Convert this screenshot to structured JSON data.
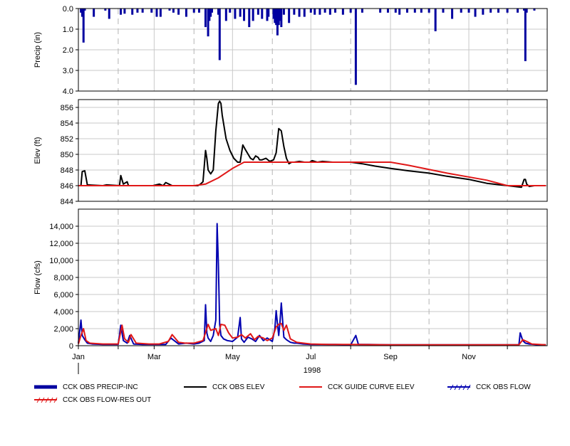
{
  "chart_data": [
    {
      "type": "bar",
      "panel": "precip",
      "ylabel": "Precip (in)",
      "ylim": [
        0,
        4
      ],
      "y_inverted": true,
      "yticks": [
        "0.0",
        "1.0",
        "2.0",
        "3.0",
        "4.0"
      ],
      "grid": true,
      "color": "#0000a0",
      "series": [
        {
          "name": "CCK OBS PRECIP-INC",
          "x": [
            "1998-01-03",
            "1998-01-04",
            "1998-01-05",
            "1998-01-06",
            "1998-01-13",
            "1998-01-22",
            "1998-01-25",
            "1998-02-03",
            "1998-02-06",
            "1998-02-12",
            "1998-02-16",
            "1998-02-20",
            "1998-02-27",
            "1998-03-03",
            "1998-03-06",
            "1998-03-13",
            "1998-03-16",
            "1998-03-20",
            "1998-03-26",
            "1998-04-01",
            "1998-04-05",
            "1998-04-10",
            "1998-04-12",
            "1998-04-13",
            "1998-04-14",
            "1998-04-15",
            "1998-04-20",
            "1998-04-21",
            "1998-04-26",
            "1998-04-29",
            "1998-05-03",
            "1998-05-07",
            "1998-05-10",
            "1998-05-14",
            "1998-05-17",
            "1998-05-21",
            "1998-05-24",
            "1998-05-28",
            "1998-05-29",
            "1998-06-02",
            "1998-06-03",
            "1998-06-04",
            "1998-06-05",
            "1998-06-06",
            "1998-06-07",
            "1998-06-08",
            "1998-06-10",
            "1998-06-14",
            "1998-06-18",
            "1998-06-22",
            "1998-06-26",
            "1998-07-01",
            "1998-07-04",
            "1998-07-08",
            "1998-07-12",
            "1998-07-16",
            "1998-07-20",
            "1998-07-26",
            "1998-08-01",
            "1998-08-05",
            "1998-08-10",
            "1998-08-24",
            "1998-08-30",
            "1998-09-05",
            "1998-09-08",
            "1998-09-14",
            "1998-09-20",
            "1998-09-25",
            "1998-10-01",
            "1998-10-06",
            "1998-10-12",
            "1998-10-19",
            "1998-10-26",
            "1998-11-01",
            "1998-11-06",
            "1998-11-12",
            "1998-11-18",
            "1998-11-24",
            "1998-12-01",
            "1998-12-09",
            "1998-12-14",
            "1998-12-15",
            "1998-12-16",
            "1998-12-22"
          ],
          "values": [
            0.2,
            0.4,
            1.65,
            0.1,
            0.4,
            0.1,
            0.5,
            0.3,
            0.25,
            0.3,
            0.2,
            0.2,
            0.2,
            0.4,
            0.4,
            0.1,
            0.2,
            0.3,
            0.4,
            0.2,
            0.2,
            0.9,
            1.35,
            0.6,
            0.4,
            0.2,
            0.3,
            2.5,
            0.6,
            0.2,
            0.5,
            0.4,
            0.6,
            0.9,
            0.6,
            0.3,
            0.5,
            0.6,
            0.4,
            0.5,
            0.7,
            0.8,
            1.3,
            0.8,
            0.6,
            0.9,
            0.3,
            0.7,
            0.3,
            0.4,
            0.4,
            0.2,
            0.3,
            0.3,
            0.2,
            0.3,
            0.2,
            0.3,
            0.2,
            3.7,
            0.2,
            0.2,
            0.2,
            0.2,
            0.3,
            0.2,
            0.2,
            0.2,
            0.2,
            1.1,
            0.2,
            0.5,
            0.2,
            0.2,
            0.4,
            0.3,
            0.2,
            0.2,
            0.2,
            0.2,
            0.1,
            2.55,
            0.2,
            0.1
          ]
        }
      ]
    },
    {
      "type": "line",
      "panel": "elev",
      "ylabel": "Elev (ft)",
      "ylim": [
        844,
        857
      ],
      "yticks": [
        "844",
        "846",
        "848",
        "850",
        "852",
        "854",
        "856"
      ],
      "grid": true,
      "series": [
        {
          "name": "CCK OBS ELEV",
          "color": "#000000",
          "x": [
            "1998-01-01",
            "1998-01-03",
            "1998-01-04",
            "1998-01-06",
            "1998-01-08",
            "1998-01-20",
            "1998-01-23",
            "1998-02-02",
            "1998-02-03",
            "1998-02-05",
            "1998-02-08",
            "1998-02-09",
            "1998-02-12",
            "1998-02-28",
            "1998-03-05",
            "1998-03-08",
            "1998-03-10",
            "1998-03-15",
            "1998-03-25",
            "1998-04-01",
            "1998-04-04",
            "1998-04-06",
            "1998-04-08",
            "1998-04-10",
            "1998-04-11",
            "1998-04-12",
            "1998-04-14",
            "1998-04-16",
            "1998-04-18",
            "1998-04-20",
            "1998-04-21",
            "1998-04-22",
            "1998-04-23",
            "1998-04-26",
            "1998-04-29",
            "1998-05-02",
            "1998-05-05",
            "1998-05-07",
            "1998-05-09",
            "1998-05-11",
            "1998-05-15",
            "1998-05-17",
            "1998-05-19",
            "1998-05-21",
            "1998-05-22",
            "1998-05-24",
            "1998-05-27",
            "1998-05-30",
            "1998-06-02",
            "1998-06-04",
            "1998-06-06",
            "1998-06-08",
            "1998-06-10",
            "1998-06-12",
            "1998-06-14",
            "1998-06-16",
            "1998-06-18",
            "1998-06-22",
            "1998-06-26",
            "1998-06-30",
            "1998-07-02",
            "1998-07-06",
            "1998-07-10",
            "1998-07-18",
            "1998-07-25",
            "1998-08-01",
            "1998-08-10",
            "1998-08-20",
            "1998-09-01",
            "1998-09-15",
            "1998-10-01",
            "1998-10-15",
            "1998-11-01",
            "1998-11-15",
            "1998-12-01",
            "1998-12-12",
            "1998-12-14",
            "1998-12-15",
            "1998-12-16",
            "1998-12-18",
            "1998-12-22",
            "1998-12-31"
          ],
          "values": [
            846.0,
            846.0,
            847.8,
            847.9,
            846.1,
            846.0,
            846.1,
            846.0,
            847.3,
            846.2,
            846.5,
            846.0,
            846.0,
            846.0,
            846.2,
            846.0,
            846.4,
            846.0,
            846.0,
            846.0,
            846.0,
            846.2,
            846.5,
            850.5,
            849.5,
            848.0,
            847.5,
            848.0,
            853.0,
            856.5,
            856.8,
            856.5,
            855.0,
            852.0,
            850.5,
            849.5,
            849.0,
            849.0,
            851.2,
            850.6,
            849.5,
            849.3,
            849.8,
            849.6,
            849.3,
            849.3,
            849.5,
            849.1,
            849.3,
            850.2,
            853.3,
            853.0,
            851.0,
            849.5,
            848.8,
            849.0,
            849.0,
            849.1,
            849.0,
            849.0,
            849.2,
            849.0,
            849.1,
            849.0,
            849.0,
            849.0,
            848.8,
            848.5,
            848.2,
            847.9,
            847.6,
            847.2,
            846.8,
            846.3,
            846.0,
            845.8,
            846.8,
            846.8,
            846.2,
            845.9,
            846.0,
            846.0
          ]
        },
        {
          "name": "CCK GUIDE CURVE ELEV",
          "color": "#e01818",
          "x": [
            "1998-01-01",
            "1998-04-01",
            "1998-04-10",
            "1998-04-20",
            "1998-05-01",
            "1998-05-10",
            "1998-09-01",
            "1998-09-15",
            "1998-10-15",
            "1998-11-15",
            "1998-12-01",
            "1998-12-31"
          ],
          "values": [
            846.0,
            846.0,
            846.2,
            847.0,
            848.2,
            849.0,
            849.0,
            848.6,
            847.6,
            846.7,
            846.0,
            846.0
          ]
        }
      ]
    },
    {
      "type": "line",
      "panel": "flow",
      "ylabel": "Flow (cfs)",
      "ylim": [
        0,
        16000
      ],
      "yticks": [
        "0",
        "2,000",
        "4,000",
        "6,000",
        "8,000",
        "10,000",
        "12,000",
        "14,000"
      ],
      "xticks": [
        "Jan",
        "Mar",
        "May",
        "Jul",
        "Sep",
        "Nov"
      ],
      "xlabel": "1998",
      "grid": true,
      "series": [
        {
          "name": "CCK OBS FLOW",
          "color": "#0000b0",
          "x": [
            "1998-01-01",
            "1998-01-03",
            "1998-01-04",
            "1998-01-06",
            "1998-01-08",
            "1998-01-12",
            "1998-01-20",
            "1998-02-01",
            "1998-02-03",
            "1998-02-05",
            "1998-02-08",
            "1998-02-10",
            "1998-02-13",
            "1998-02-20",
            "1998-03-01",
            "1998-03-10",
            "1998-03-14",
            "1998-03-20",
            "1998-03-26",
            "1998-04-01",
            "1998-04-05",
            "1998-04-09",
            "1998-04-10",
            "1998-04-11",
            "1998-04-12",
            "1998-04-14",
            "1998-04-16",
            "1998-04-18",
            "1998-04-19",
            "1998-04-20",
            "1998-04-21",
            "1998-04-22",
            "1998-04-24",
            "1998-04-27",
            "1998-05-01",
            "1998-05-05",
            "1998-05-07",
            "1998-05-08",
            "1998-05-10",
            "1998-05-13",
            "1998-05-16",
            "1998-05-19",
            "1998-05-22",
            "1998-05-25",
            "1998-05-28",
            "1998-06-01",
            "1998-06-03",
            "1998-06-04",
            "1998-06-05",
            "1998-06-06",
            "1998-06-07",
            "1998-06-08",
            "1998-06-10",
            "1998-06-12",
            "1998-06-15",
            "1998-06-18",
            "1998-06-20",
            "1998-06-25",
            "1998-07-01",
            "1998-07-10",
            "1998-07-20",
            "1998-08-01",
            "1998-08-05",
            "1998-08-07",
            "1998-08-15",
            "1998-09-01",
            "1998-10-01",
            "1998-11-01",
            "1998-12-01",
            "1998-12-10",
            "1998-12-11",
            "1998-12-13",
            "1998-12-15",
            "1998-12-18",
            "1998-12-25",
            "1998-12-31"
          ],
          "values": [
            300,
            3000,
            1200,
            700,
            300,
            200,
            150,
            150,
            2400,
            600,
            300,
            1200,
            200,
            150,
            150,
            150,
            900,
            200,
            300,
            200,
            300,
            600,
            4800,
            1500,
            900,
            500,
            1200,
            3000,
            14300,
            9500,
            2500,
            1200,
            800,
            600,
            500,
            1000,
            3300,
            800,
            400,
            1000,
            800,
            500,
            1200,
            600,
            900,
            500,
            2000,
            4100,
            2600,
            1200,
            2800,
            5000,
            1000,
            700,
            400,
            300,
            300,
            200,
            150,
            150,
            150,
            100,
            1200,
            150,
            150,
            100,
            100,
            100,
            100,
            100,
            1500,
            600,
            300,
            200,
            100,
            100
          ]
        },
        {
          "name": "CCK OBS FLOW-RES OUT",
          "color": "#e01818",
          "x": [
            "1998-01-01",
            "1998-01-03",
            "1998-01-05",
            "1998-01-07",
            "1998-01-10",
            "1998-01-20",
            "1998-02-01",
            "1998-02-04",
            "1998-02-06",
            "1998-02-09",
            "1998-02-11",
            "1998-02-15",
            "1998-02-25",
            "1998-03-05",
            "1998-03-12",
            "1998-03-15",
            "1998-03-20",
            "1998-03-25",
            "1998-04-01",
            "1998-04-08",
            "1998-04-12",
            "1998-04-14",
            "1998-04-18",
            "1998-04-20",
            "1998-04-22",
            "1998-04-25",
            "1998-04-28",
            "1998-05-01",
            "1998-05-05",
            "1998-05-08",
            "1998-05-11",
            "1998-05-15",
            "1998-05-18",
            "1998-05-21",
            "1998-05-25",
            "1998-05-28",
            "1998-06-01",
            "1998-06-04",
            "1998-06-06",
            "1998-06-08",
            "1998-06-10",
            "1998-06-12",
            "1998-06-15",
            "1998-06-20",
            "1998-06-25",
            "1998-07-01",
            "1998-07-15",
            "1998-08-01",
            "1998-09-01",
            "1998-10-01",
            "1998-11-01",
            "1998-12-01",
            "1998-12-10",
            "1998-12-13",
            "1998-12-16",
            "1998-12-20",
            "1998-12-31"
          ],
          "values": [
            200,
            1200,
            2000,
            600,
            300,
            200,
            200,
            2400,
            800,
            400,
            1300,
            300,
            200,
            200,
            500,
            1300,
            400,
            300,
            300,
            600,
            2500,
            1800,
            2000,
            1200,
            2500,
            2400,
            1500,
            900,
            1000,
            1300,
            900,
            1400,
            700,
            1100,
            900,
            600,
            900,
            2200,
            2500,
            2600,
            1800,
            2400,
            800,
            400,
            300,
            200,
            150,
            150,
            100,
            100,
            100,
            100,
            100,
            700,
            500,
            200,
            100
          ]
        }
      ]
    }
  ],
  "legend": [
    {
      "label": "CCK OBS PRECIP-INC",
      "style": "thick-bar",
      "color": "#0000a0"
    },
    {
      "label": "CCK OBS ELEV",
      "style": "line",
      "color": "#000000"
    },
    {
      "label": "CCK GUIDE CURVE ELEV",
      "style": "line",
      "color": "#e01818"
    },
    {
      "label": "CCK OBS FLOW",
      "style": "hatched-line",
      "color": "#0000b0"
    },
    {
      "label": "CCK OBS FLOW-RES OUT",
      "style": "hatched-line",
      "color": "#e01818"
    }
  ]
}
